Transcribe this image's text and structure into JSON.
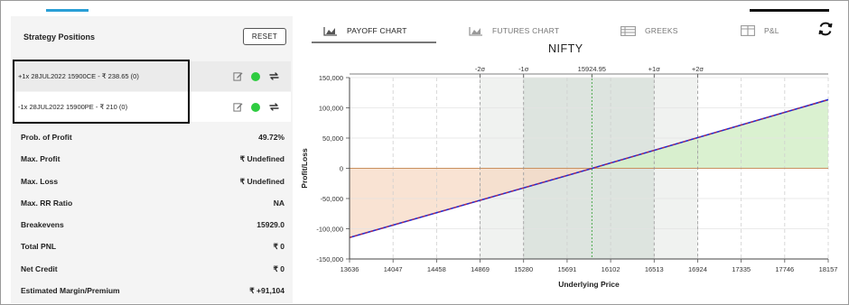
{
  "left_panel": {
    "title": "Strategy Positions",
    "reset_label": "RESET",
    "positions": [
      {
        "text": "+1x  28JUL2022  15900CE  - ₹ 238.65  (0)",
        "status_color": "#2ecc40"
      },
      {
        "text": "-1x  28JUL2022  15900PE  - ₹ 210  (0)",
        "status_color": "#2ecc40"
      }
    ],
    "stats": [
      {
        "label": "Prob. of Profit",
        "value": "49.72%"
      },
      {
        "label": "Max. Profit",
        "value": "₹ Undefined"
      },
      {
        "label": "Max. Loss",
        "value": "₹ Undefined"
      },
      {
        "label": "Max. RR Ratio",
        "value": "NA"
      },
      {
        "label": "Breakevens",
        "value": "15929.0"
      },
      {
        "label": "Total PNL",
        "value": "₹ 0"
      },
      {
        "label": "Net Credit",
        "value": "₹ 0"
      },
      {
        "label": "Estimated Margin/Premium",
        "value": "₹ +91,104"
      }
    ]
  },
  "tabs": [
    {
      "label": "PAYOFF CHART",
      "icon": "area-chart-icon",
      "active": true
    },
    {
      "label": "FUTURES CHART",
      "icon": "area-chart-icon",
      "active": false
    },
    {
      "label": "GREEKS",
      "icon": "table-icon",
      "active": false
    },
    {
      "label": "P&L",
      "icon": "grid-icon",
      "active": false
    }
  ],
  "chart_data": {
    "type": "line",
    "title": "NIFTY",
    "xlabel": "Underlying Price",
    "ylabel": "Profit/Loss",
    "x_ticks": [
      13636,
      14047,
      14458,
      14869,
      15280,
      15691,
      16102,
      16513,
      16924,
      17335,
      17746,
      18157
    ],
    "y_ticks": [
      150000,
      100000,
      50000,
      0,
      -50000,
      -100000,
      -150000
    ],
    "y_tick_labels": [
      "150,000",
      "100,000",
      "50,000",
      "0",
      "-50,000",
      "-100,000",
      "-150,000"
    ],
    "xlim": [
      13636,
      18157
    ],
    "ylim": [
      -150000,
      150000
    ],
    "sigma_markers": [
      {
        "label": "-2σ",
        "x": 14869
      },
      {
        "label": "-1σ",
        "x": 15280
      },
      {
        "label": "15924.95",
        "x": 15924.95
      },
      {
        "label": "+1σ",
        "x": 16513
      },
      {
        "label": "+2σ",
        "x": 16924
      }
    ],
    "series": [
      {
        "values": [
          [
            13636,
            -114500
          ],
          [
            15929,
            0
          ],
          [
            18157,
            113500
          ]
        ],
        "color": "#1f2bd6"
      }
    ],
    "loss_fill_color": "#f7d9c4",
    "profit_fill_color": "#d4efc8",
    "grid": true
  }
}
